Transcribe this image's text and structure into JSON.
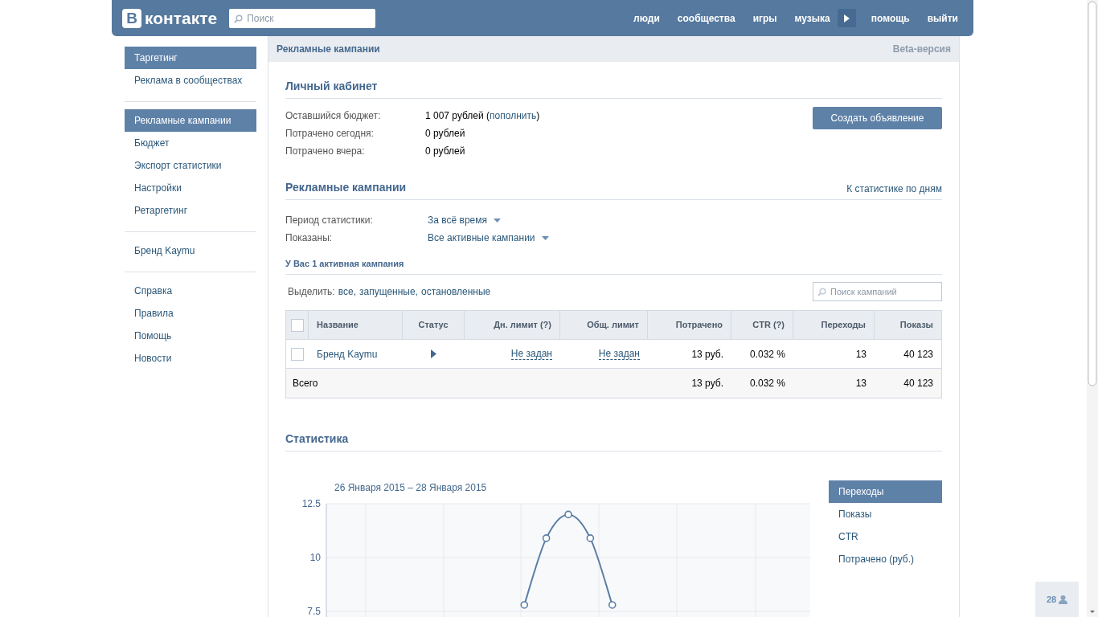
{
  "header": {
    "logo_badge": "В",
    "logo_text": "контакте",
    "search": {
      "placeholder": "Поиск"
    },
    "nav": [
      {
        "kind": "link",
        "label": "люди"
      },
      {
        "kind": "link",
        "label": "сообщества"
      },
      {
        "kind": "link",
        "label": "игры"
      },
      {
        "kind": "link",
        "label": "музыка"
      },
      {
        "kind": "play"
      },
      {
        "kind": "link",
        "label": "помощь"
      },
      {
        "kind": "link",
        "label": "выйти"
      }
    ]
  },
  "sidebar": {
    "groups": [
      {
        "items": [
          {
            "label": "Таргетинг",
            "selected": true
          },
          {
            "label": "Реклама в сообществах",
            "selected": false
          }
        ]
      },
      {
        "items": [
          {
            "label": "Рекламные кампании",
            "selected": true
          },
          {
            "label": "Бюджет",
            "selected": false
          },
          {
            "label": "Экспорт статистики",
            "selected": false
          },
          {
            "label": "Настройки",
            "selected": false
          },
          {
            "label": "Ретаргетинг",
            "selected": false
          }
        ]
      },
      {
        "items": [
          {
            "label": "Бренд Kaymu",
            "selected": false
          }
        ]
      },
      {
        "items": [
          {
            "label": "Справка",
            "selected": false
          },
          {
            "label": "Правила",
            "selected": false
          },
          {
            "label": "Помощь",
            "selected": false
          },
          {
            "label": "Новости",
            "selected": false
          }
        ]
      }
    ]
  },
  "page": {
    "title": "Рекламные кампании",
    "badge": "Beta-версия"
  },
  "cabinet": {
    "title": "Личный кабинет",
    "button": "Создать объявление",
    "rows": [
      {
        "label": "Оставшийся бюджет:",
        "value": "1 007 рублей (",
        "link": "пополнить",
        "value_after": ")"
      },
      {
        "label": "Потрачено сегодня:",
        "value": "0 рублей"
      },
      {
        "label": "Потрачено вчера:",
        "value": "0 рублей"
      }
    ]
  },
  "campaigns": {
    "title": "Рекламные кампании",
    "link": "К статистике по дням",
    "filters": [
      {
        "label": "Период статистики:",
        "value": "За всё время"
      },
      {
        "label": "Показаны:",
        "value": "Все активные кампании"
      }
    ],
    "subtitle": "У Вас 1 активная кампания",
    "select_prefix": "Выделить:",
    "select_links": [
      "все",
      "запущенные",
      "остановленные"
    ],
    "separator": ",",
    "search": {
      "placeholder": "Поиск кампаний"
    },
    "table": {
      "header_checked": false,
      "columns": [
        {
          "label": "Название"
        },
        {
          "label": "Статус"
        },
        {
          "label": "Дн. лимит (?)"
        },
        {
          "label": "Общ. лимит"
        },
        {
          "label": "Потрачено"
        },
        {
          "label": "CTR (?)"
        },
        {
          "label": "Переходы"
        },
        {
          "label": "Показы"
        }
      ],
      "rows": [
        {
          "checked": false,
          "name": "Бренд Kaymu",
          "running": true,
          "daily_limit": "Не задан",
          "total_limit": "Не задан",
          "spent": "13 руб.",
          "ctr": "0.032 %",
          "clicks": "13",
          "impressions": "40 123"
        }
      ],
      "total": {
        "label": "Всего",
        "spent": "13 руб.",
        "ctr": "0.032 %",
        "clicks": "13",
        "impressions": "40 123"
      }
    }
  },
  "stats": {
    "title": "Статистика",
    "period": "26 Января 2015 – 28 Января 2015",
    "metrics": [
      {
        "label": "Переходы",
        "selected": true
      },
      {
        "label": "Показы",
        "selected": false
      },
      {
        "label": "CTR",
        "selected": false
      },
      {
        "label": "Потрачено (руб.)",
        "selected": false
      }
    ],
    "chart_data": {
      "type": "line",
      "grid": true,
      "ylim": [
        0,
        12.5
      ],
      "yticks": [
        7.5,
        10,
        12.5
      ],
      "series": [
        {
          "color": "#5b7ea5",
          "marker": true,
          "values": [
            null,
            null,
            null,
            null,
            null,
            null,
            null,
            null,
            null,
            7.8,
            10.9,
            12,
            10.9,
            7.8,
            null,
            null,
            null,
            null,
            null,
            null,
            null,
            null,
            null
          ]
        }
      ]
    }
  },
  "corner": {
    "count": "28"
  }
}
